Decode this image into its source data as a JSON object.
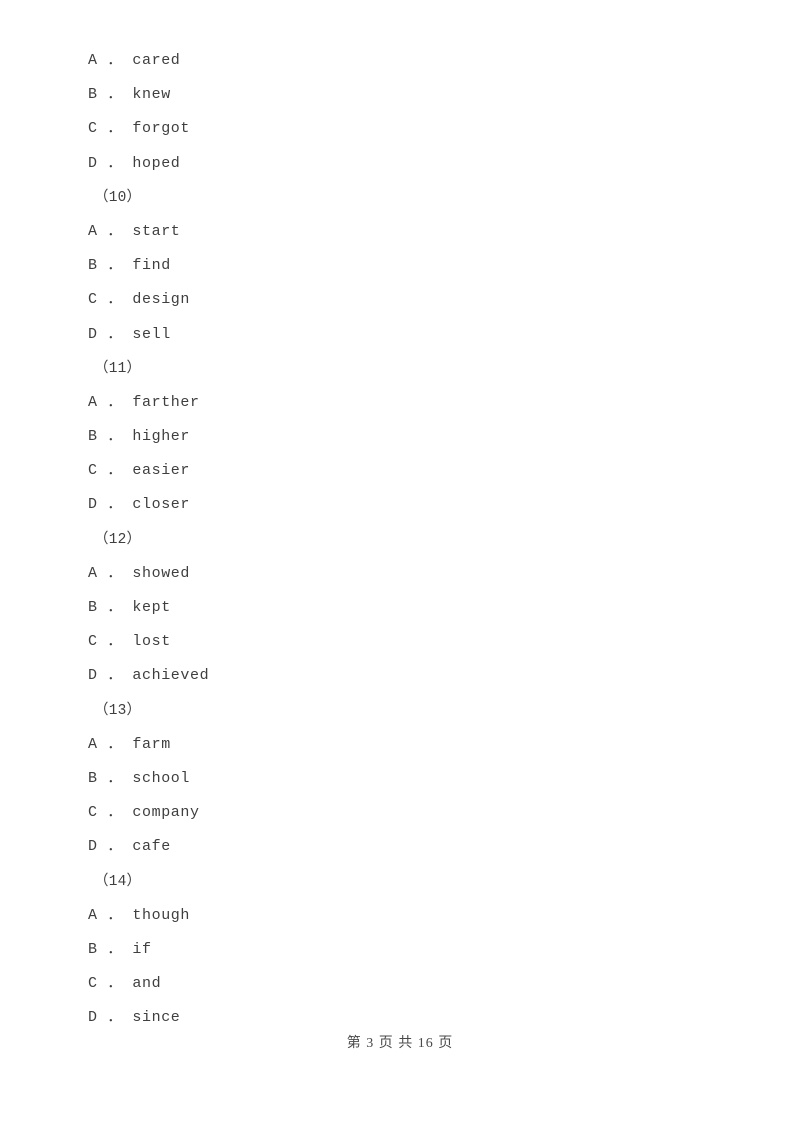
{
  "document": {
    "page_background": "#ffffff",
    "text_color": "#3f3f3f",
    "lines": [
      {
        "kind": "option",
        "text": "A ． cared"
      },
      {
        "kind": "option",
        "text": "B ． knew"
      },
      {
        "kind": "option",
        "text": "C ． forgot"
      },
      {
        "kind": "option",
        "text": "D ． hoped"
      },
      {
        "kind": "qnum",
        "text": "（10）"
      },
      {
        "kind": "option",
        "text": "A ． start"
      },
      {
        "kind": "option",
        "text": "B ． find"
      },
      {
        "kind": "option",
        "text": "C ． design"
      },
      {
        "kind": "option",
        "text": "D ． sell"
      },
      {
        "kind": "qnum",
        "text": "（11）"
      },
      {
        "kind": "option",
        "text": "A ． farther"
      },
      {
        "kind": "option",
        "text": "B ． higher"
      },
      {
        "kind": "option",
        "text": "C ． easier"
      },
      {
        "kind": "option",
        "text": "D ． closer"
      },
      {
        "kind": "qnum",
        "text": "（12）"
      },
      {
        "kind": "option",
        "text": "A ． showed"
      },
      {
        "kind": "option",
        "text": "B ． kept"
      },
      {
        "kind": "option",
        "text": "C ． lost"
      },
      {
        "kind": "option",
        "text": "D ． achieved"
      },
      {
        "kind": "qnum",
        "text": "（13）"
      },
      {
        "kind": "option",
        "text": "A ． farm"
      },
      {
        "kind": "option",
        "text": "B ． school"
      },
      {
        "kind": "option",
        "text": "C ． company"
      },
      {
        "kind": "option",
        "text": "D ． cafe"
      },
      {
        "kind": "qnum",
        "text": "（14）"
      },
      {
        "kind": "option",
        "text": "A ． though"
      },
      {
        "kind": "option",
        "text": "B ． if"
      },
      {
        "kind": "option",
        "text": "C ． and"
      },
      {
        "kind": "option",
        "text": "D ． since"
      }
    ],
    "footer": {
      "text": "第 3 页 共 16 页",
      "current_page": "3",
      "total_pages": "16"
    }
  }
}
